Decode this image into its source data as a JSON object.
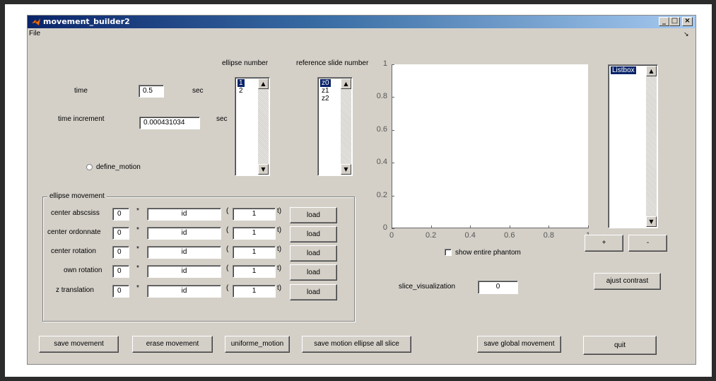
{
  "window": {
    "title": "movement_builder2"
  },
  "menu": {
    "file": "File",
    "arrow": "↘"
  },
  "time": {
    "label": "time",
    "value": "0.5",
    "unit": "sec"
  },
  "time_increment": {
    "label": "time increment",
    "value": "0.000431034",
    "unit": "sec"
  },
  "define_motion": {
    "label": "define_motion"
  },
  "ellipse_list": {
    "label": "ellipse number",
    "items": [
      "1",
      "2"
    ],
    "selected": "1"
  },
  "reference_list": {
    "label": "reference slide number",
    "items": [
      "z0",
      "z1",
      "z2"
    ],
    "selected": "z0"
  },
  "right_list": {
    "items": [
      "Listbox"
    ],
    "selected": "Listbox"
  },
  "movement": {
    "group_label": "ellipse movement",
    "rows": [
      {
        "label": "center abscsiss",
        "coef": "0",
        "func": "id",
        "arg": "1",
        "load": "load"
      },
      {
        "label": "center ordonnate",
        "coef": "0",
        "func": "id",
        "arg": "1",
        "load": "load"
      },
      {
        "label": "center   rotation",
        "coef": "0",
        "func": "id",
        "arg": "1",
        "load": "load"
      },
      {
        "label": "own rotation",
        "coef": "0",
        "func": "id",
        "arg": "1",
        "load": "load"
      },
      {
        "label": "z translation",
        "coef": "0",
        "func": "id",
        "arg": "1",
        "load": "load"
      }
    ],
    "star": "*",
    "paren": "(",
    "t": "t)"
  },
  "plot": {
    "y_ticks": [
      "1",
      "0.8",
      "0.6",
      "0.4",
      "0.2",
      "0"
    ],
    "x_ticks": [
      "0",
      "0.2",
      "0.4",
      "0.6",
      "0.8",
      "1"
    ]
  },
  "show_entire_phantom": {
    "label": "show entire phantom",
    "checked": false
  },
  "plus_button": "+",
  "minus_button": "-",
  "adjust_contrast": "ajust contrast",
  "slice_visualization": {
    "label": "slice_visualization",
    "value": "0"
  },
  "buttons": {
    "save_movement": "save movement",
    "erase_movement": "erase movement",
    "uniforme_motion": "uniforme_motion",
    "save_motion_ellipse_all_slice": "save motion ellipse all slice",
    "save_global_movement": "save global movement",
    "quit": "quit"
  }
}
